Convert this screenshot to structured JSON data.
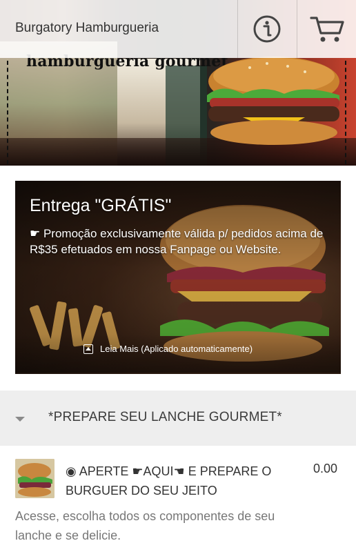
{
  "app": {
    "title": "Burgatory Hamburgueria",
    "banner_tagline": "hamburgueria gourmet",
    "info_icon": "info-icon",
    "cart_icon": "cart-icon"
  },
  "promo": {
    "title": "Entrega \"GRÁTIS\"",
    "description": "☛ Promoção exclusivamente válida p/ pedidos acima de R$35 efetuados em nossa Fanpage ou Website.",
    "read_more": "Leia Mais (Aplicado automaticamente)",
    "read_more_icon": "expand-icon"
  },
  "section": {
    "title": "*PREPARE SEU LANCHE GOURMET*",
    "chevron_icon": "chevron-down-icon"
  },
  "product": {
    "name": "◉ APERTE ☛AQUI☚ E PREPARE O BURGUER DO SEU JEITO",
    "price": "0.00",
    "description": "Acesse, escolha todos os componentes de seu lanche e se delicie."
  },
  "colors": {
    "appbar_bg": "#ffffff",
    "section_bg": "#eeeeee",
    "text_primary": "#333333",
    "text_secondary": "#777777"
  }
}
